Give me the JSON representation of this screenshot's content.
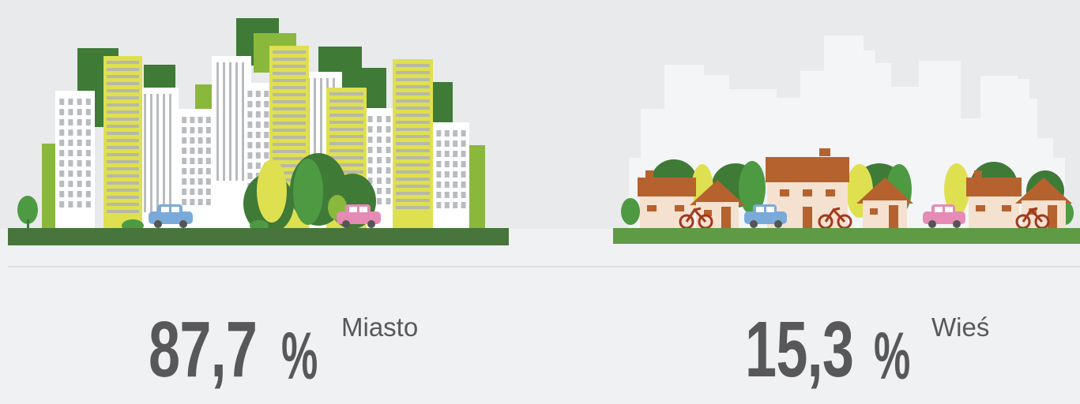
{
  "stats": [
    {
      "value": "87,7",
      "unit": "%",
      "label": "Miasto"
    },
    {
      "value": "15,3",
      "unit": "%",
      "label": "Wieś"
    }
  ],
  "colors": {
    "text": "#58585a",
    "dark_green": "#3f7a37",
    "green": "#4d9a42",
    "lime": "#8ab83c",
    "yellow": "#dfe04f",
    "house_roof": "#b5622f",
    "house_wall": "#f5e1cf",
    "car_blue": "#7aaad9",
    "car_pink": "#e58bb5",
    "bike": "#a2381d"
  }
}
